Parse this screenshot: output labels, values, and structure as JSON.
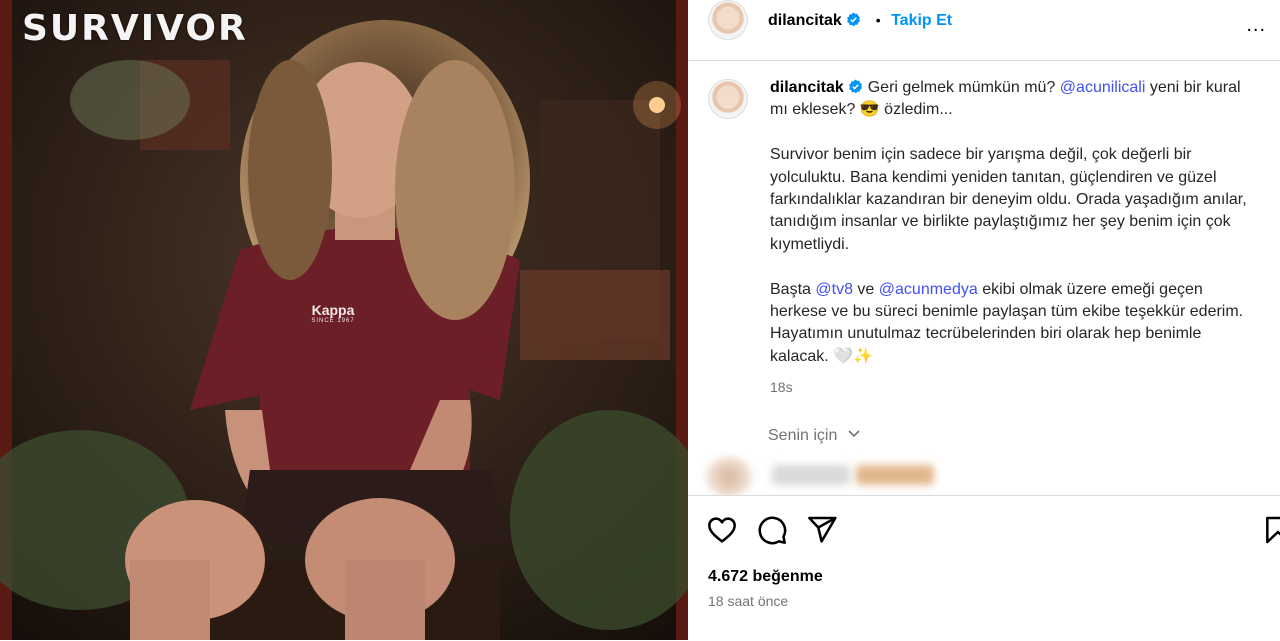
{
  "photo": {
    "brand": "SURVIVOR",
    "shirt_logo": "Kappa",
    "shirt_since": "SINCE 1967"
  },
  "header": {
    "username": "dilancitak",
    "separator": "•",
    "follow_label": "Takip Et",
    "more_label": "..."
  },
  "caption": {
    "username": "dilancitak",
    "line1_pre": "Geri gelmek mümkün mü?",
    "mention1": "@acunilicali",
    "line1_post": "yeni bir kural mı eklesek? 😎 özledim...",
    "para2": "Survivor benim için sadece bir yarışma değil, çok değerli bir yolculuktu. Bana kendimi yeniden tanıtan, güçlendiren ve güzel farkındalıklar kazandıran bir deneyim oldu. Orada yaşadığım anılar, tanıdığım insanlar ve birlikte paylaştığımız her şey benim için çok kıymetliydi.",
    "para3_a": "Başta",
    "mention2": "@tv8",
    "para3_b": "ve",
    "mention3": "@acunmedya",
    "para3_c": "ekibi olmak üzere emeği geçen herkese ve bu süreci benimle paylaşan tüm ekibe teşekkür ederim. Hayatımın unutulmaz tecrübelerinden biri olarak hep benimle kalacak. 🤍✨",
    "time": "18s"
  },
  "for_you": "Senin için",
  "likes": "4.672 beğenme",
  "posted": "18 saat önce",
  "colors": {
    "link": "#4150f7",
    "follow": "#0095f6",
    "verified": "#0095f6",
    "muted": "#737373"
  },
  "icons": [
    "heart-icon",
    "comment-icon",
    "share-icon",
    "bookmark-icon",
    "chevron-down-icon",
    "verified-badge-icon"
  ]
}
